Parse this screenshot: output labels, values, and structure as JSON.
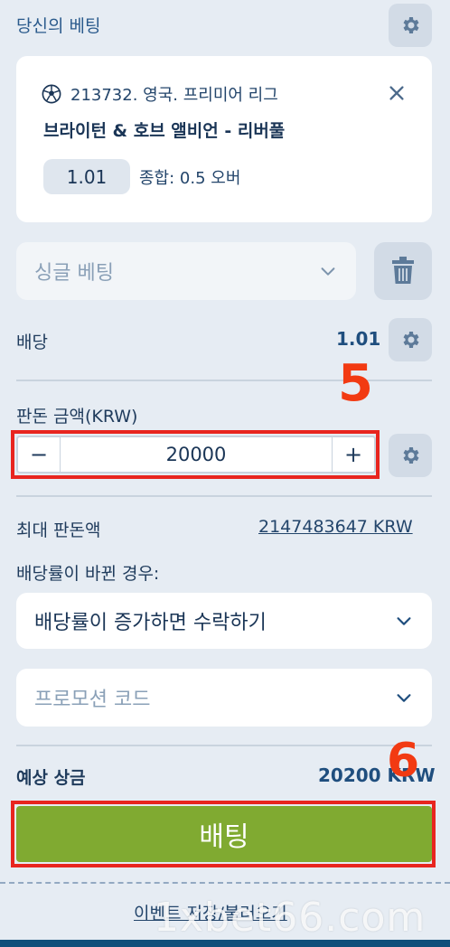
{
  "header": {
    "title": "당신의 베팅"
  },
  "bet": {
    "event": "213732. 영국. 프리미어 리그",
    "match": "브라이턴 & 호브 앨비언 - 리버풀",
    "odds": "1.01",
    "market": "종합: 0.5 오버"
  },
  "bet_type": {
    "selected": "싱글 베팅"
  },
  "coef": {
    "label": "배당",
    "value": "1.01"
  },
  "stake": {
    "label": "판돈 금액(KRW)",
    "minus": "−",
    "value": "20000",
    "plus": "+"
  },
  "max_stake": {
    "label": "최대 판돈액",
    "value": "2147483647 KRW"
  },
  "odds_change": {
    "label": "배당률이 바뀐 경우:",
    "selected": "배당률이 증가하면 수락하기"
  },
  "promo": {
    "placeholder": "프로모션 코드"
  },
  "payout": {
    "label": "예상 상금",
    "value": "20200 KRW"
  },
  "place_bet": {
    "label": "배팅"
  },
  "footer": {
    "link": "이벤트 저장/불러오기"
  },
  "annotations": {
    "step5": "5",
    "step6": "6"
  },
  "watermark": "1xbet66.com",
  "colors": {
    "accent": "#80aa31",
    "highlight": "#e8251f",
    "brand": "#0f4f7a"
  }
}
